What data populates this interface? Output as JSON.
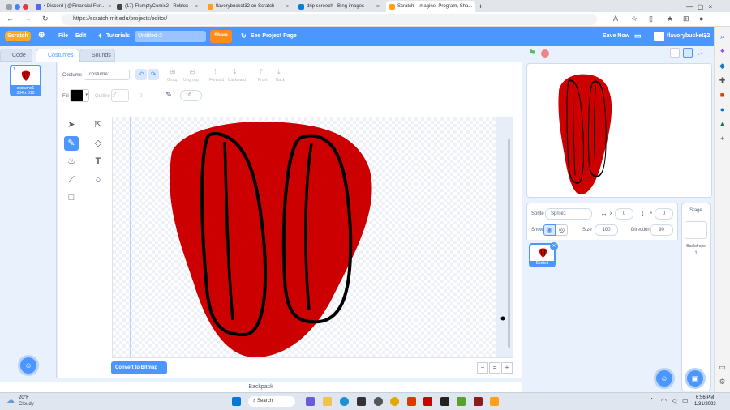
{
  "browser": {
    "tabs": [
      {
        "label": "• Discord | @Financial Fun...",
        "color": "#5865f2"
      },
      {
        "label": "(17) FlumptyComic2 - Roblox",
        "color": "#444444"
      },
      {
        "label": "flavorybucket32 on Scratch",
        "color": "#ff9f1a"
      },
      {
        "label": "drip screech - Bing images",
        "color": "#0d7dd4"
      },
      {
        "label": "Scratch - Imagine, Program, Sha...",
        "color": "#ff9f1a"
      }
    ],
    "new_tab": "+",
    "url": "https://scratch.mit.edu/projects/editor/"
  },
  "menu": {
    "logo": "Scratch",
    "file": "File",
    "edit": "Edit",
    "tutorials": "Tutorials",
    "project_title": "Untitled-2",
    "share": "Share",
    "see_project": "See Project Page",
    "save_now": "Save Now",
    "username": "flavorybucket32"
  },
  "editor_tabs": {
    "code": "Code",
    "costumes": "Costumes",
    "sounds": "Sounds"
  },
  "costume_card": {
    "number": "1",
    "name": "costume1",
    "size": "384 x 310"
  },
  "paint": {
    "costume_label": "Costume",
    "costume_name": "costume1",
    "group": "Group",
    "ungroup": "Ungroup",
    "forward": "Forward",
    "backward": "Backward",
    "front": "Front",
    "back": "Back",
    "fill_label": "Fill",
    "fill_color": "#000000",
    "outline_label": "Outline",
    "outline_value": "0",
    "brush_size": "10",
    "convert": "Convert to Bitmap",
    "zoom_out": "−",
    "zoom_reset": "=",
    "zoom_in": "+"
  },
  "drawing": {
    "fill": "#cc0000",
    "stroke": "#000000"
  },
  "sprite_info": {
    "sprite_label": "Sprite",
    "sprite_name": "Sprite1",
    "x_label": "x",
    "x": "0",
    "y_label": "y",
    "y": "0",
    "show_label": "Show",
    "size_label": "Size",
    "size": "100",
    "direction_label": "Direction",
    "direction": "90"
  },
  "sprite_tile": {
    "name": "Sprite1"
  },
  "stage_col": {
    "title": "Stage",
    "backdrops_label": "Backdrops",
    "backdrops": "1"
  },
  "backpack": "Backpack",
  "taskbar": {
    "temp": "20°F",
    "weather": "Cloudy",
    "search": "Search",
    "time": "6:56 PM",
    "date": "1/31/2023"
  }
}
